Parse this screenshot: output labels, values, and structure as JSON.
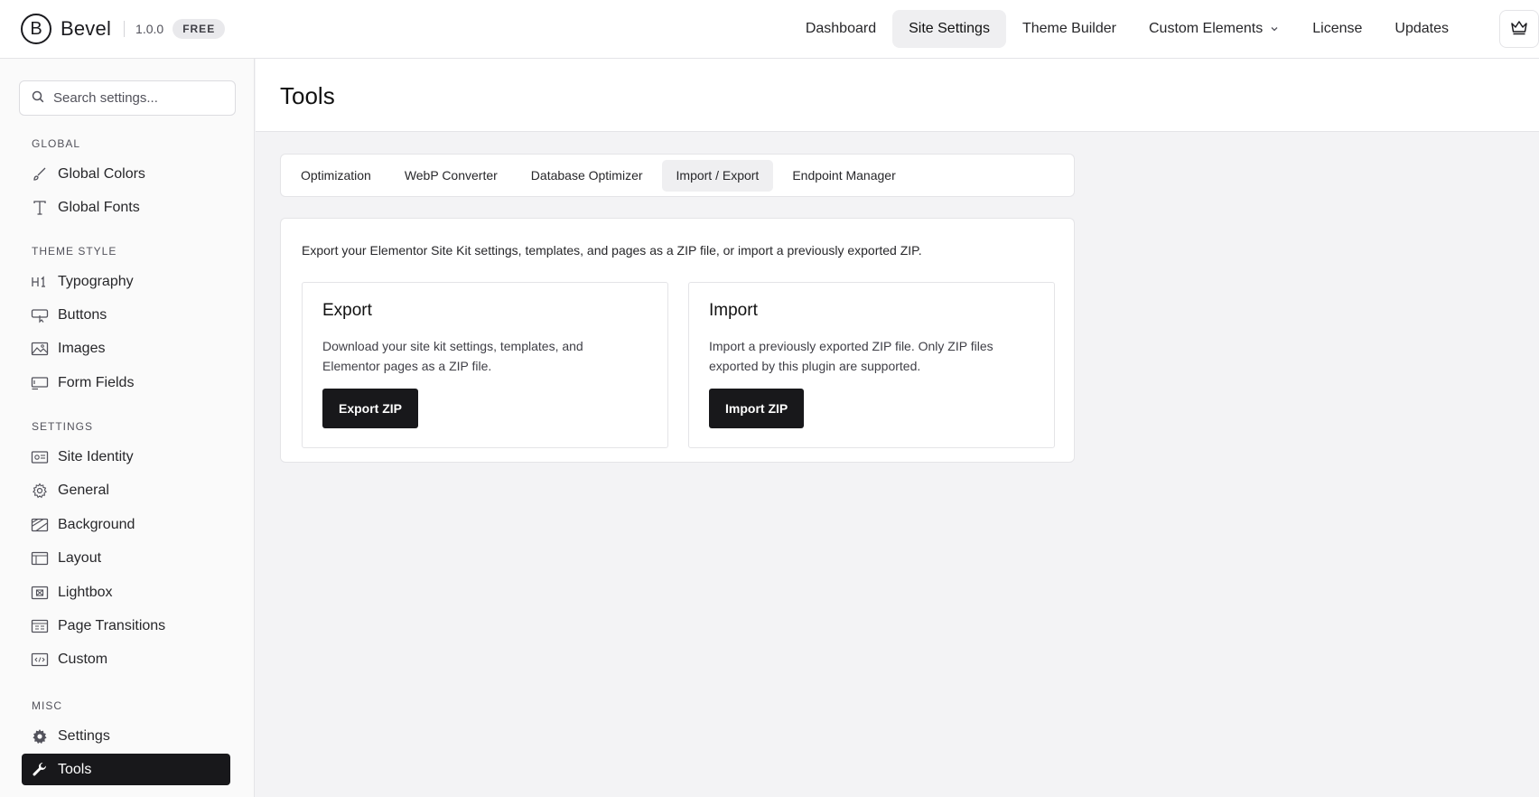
{
  "brand": {
    "logo_letter": "B",
    "name": "Bevel",
    "version": "1.0.0",
    "plan_badge": "FREE"
  },
  "nav": {
    "items": [
      {
        "label": "Dashboard",
        "active": false
      },
      {
        "label": "Site Settings",
        "active": true
      },
      {
        "label": "Theme Builder",
        "active": false
      },
      {
        "label": "Custom Elements",
        "active": false,
        "has_dropdown": true
      },
      {
        "label": "License",
        "active": false
      },
      {
        "label": "Updates",
        "active": false
      }
    ],
    "crown_icon": "crown-icon"
  },
  "sidebar": {
    "search_placeholder": "Search settings...",
    "sections": {
      "global": "GLOBAL",
      "theme_style": "THEME STYLE",
      "settings": "SETTINGS",
      "misc": "MISC"
    },
    "items": [
      {
        "label": "Global Colors",
        "icon": "brush-icon"
      },
      {
        "label": "Global Fonts",
        "icon": "font-icon"
      },
      {
        "label": "Typography",
        "icon": "heading-icon"
      },
      {
        "label": "Buttons",
        "icon": "button-cursor-icon"
      },
      {
        "label": "Images",
        "icon": "image-icon"
      },
      {
        "label": "Form Fields",
        "icon": "form-field-icon"
      },
      {
        "label": "Site Identity",
        "icon": "id-card-icon"
      },
      {
        "label": "General",
        "icon": "gear-outline-icon"
      },
      {
        "label": "Background",
        "icon": "background-icon"
      },
      {
        "label": "Layout",
        "icon": "layout-icon"
      },
      {
        "label": "Lightbox",
        "icon": "lightbox-icon"
      },
      {
        "label": "Page Transitions",
        "icon": "transition-icon"
      },
      {
        "label": "Custom",
        "icon": "code-icon"
      },
      {
        "label": "Settings",
        "icon": "gear-icon"
      },
      {
        "label": "Tools",
        "icon": "wrench-icon",
        "active": true
      }
    ]
  },
  "page": {
    "title": "Tools"
  },
  "tabs": [
    {
      "label": "Optimization",
      "active": false
    },
    {
      "label": "WebP Converter",
      "active": false
    },
    {
      "label": "Database Optimizer",
      "active": false
    },
    {
      "label": "Import / Export",
      "active": true
    },
    {
      "label": "Endpoint Manager",
      "active": false
    }
  ],
  "import_export": {
    "description": "Export your Elementor Site Kit settings, templates, and pages as a ZIP file, or import a previously exported ZIP.",
    "export": {
      "title": "Export",
      "text": "Download your site kit settings, templates, and Elementor pages as a ZIP file.",
      "button": "Export ZIP"
    },
    "import": {
      "title": "Import",
      "text": "Import a previously exported ZIP file. Only ZIP files exported by this plugin are supported.",
      "button": "Import ZIP"
    }
  },
  "colors": {
    "accent_dark": "#18181b",
    "background": "#f3f3f5",
    "border": "#e4e4e7"
  }
}
